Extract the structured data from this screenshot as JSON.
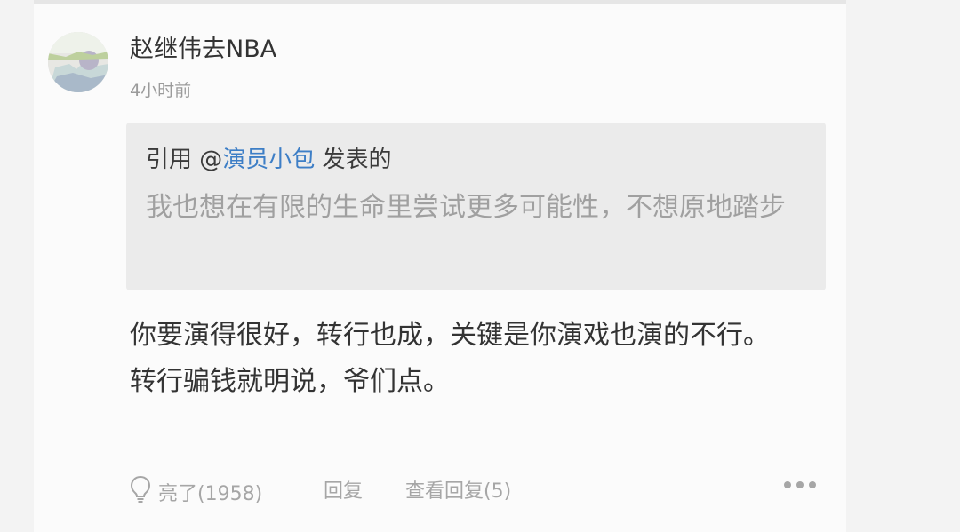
{
  "comment": {
    "username": "赵继伟去NBA",
    "timestamp": "4小时前",
    "quote": {
      "prefix": "引用 @",
      "mention": "演员小包",
      "suffix": " 发表的",
      "text": "我也想在有限的生命里尝试更多可能性，不想原地踏步"
    },
    "body_lines": [
      "你要演得很好，转行也成，关键是你演戏也演的不行。",
      "转行骗钱就明说，爷们点。"
    ],
    "actions": {
      "like_label": "亮了(1958)",
      "reply_label": "回复",
      "view_replies_label": "查看回复(5)"
    }
  },
  "icons": {
    "like": "lightbulb-icon",
    "more": "more-dots-icon"
  },
  "colors": {
    "mention": "#3d7ec6",
    "quote_background": "#ebebeb",
    "meta_text": "#a6a6a6"
  }
}
